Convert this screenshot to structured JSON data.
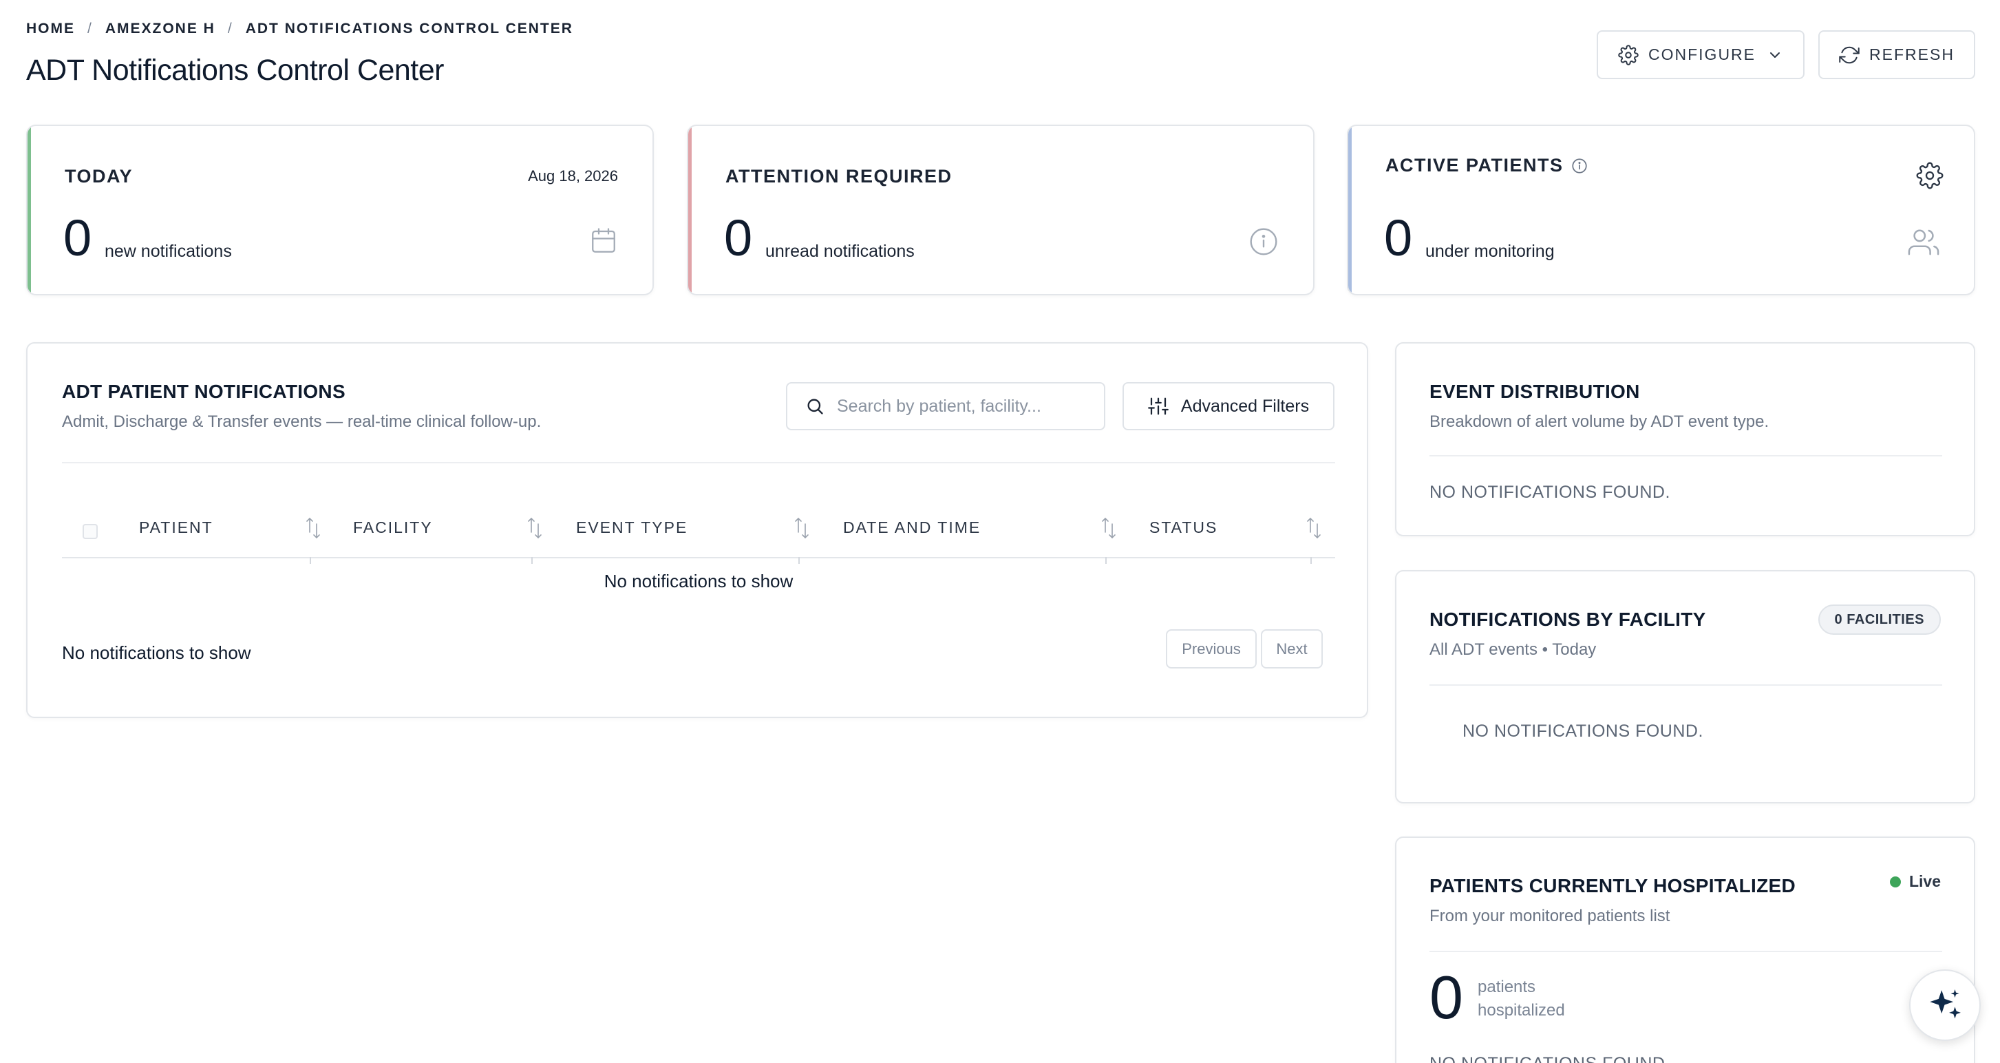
{
  "breadcrumb": {
    "items": [
      "HOME",
      "AMEXZONE H",
      "ADT NOTIFICATIONS CONTROL CENTER"
    ],
    "separator": "/"
  },
  "page": {
    "title": "ADT Notifications Control Center"
  },
  "toolbar": {
    "configure_label": "CONFIGURE",
    "refresh_label": "REFRESH"
  },
  "stats": {
    "today": {
      "label": "TODAY",
      "date": "Aug 18, 2026",
      "value": "0",
      "sub": "new notifications",
      "accent": "#7dbf8e",
      "icon": "calendar-icon"
    },
    "attention": {
      "label": "ATTENTION REQUIRED",
      "value": "0",
      "sub": "unread notifications",
      "accent": "#e0a3a8",
      "icon": "info-icon"
    },
    "active": {
      "label": "ACTIVE PATIENTS",
      "value": "0",
      "sub": "under monitoring",
      "accent": "#a9bde0",
      "icon": "users-icon"
    }
  },
  "notifications": {
    "title": "ADT PATIENT NOTIFICATIONS",
    "subtitle": "Admit, Discharge & Transfer events — real-time clinical follow-up.",
    "search_placeholder": "Search by patient, facility...",
    "filters_label": "Advanced Filters",
    "columns": [
      "PATIENT",
      "FACILITY",
      "EVENT TYPE",
      "DATE AND TIME",
      "STATUS"
    ],
    "empty_message": "No notifications to show",
    "footer_message": "No notifications to show",
    "previous_label": "Previous",
    "next_label": "Next"
  },
  "event_distribution": {
    "title": "EVENT DISTRIBUTION",
    "subtitle": "Breakdown of alert volume by ADT event type.",
    "empty": "NO NOTIFICATIONS FOUND."
  },
  "by_facility": {
    "title": "NOTIFICATIONS BY FACILITY",
    "badge": "0 FACILITIES",
    "subtitle": "All ADT events • Today",
    "empty": "NO NOTIFICATIONS FOUND."
  },
  "hospitalized": {
    "title": "PATIENTS CURRENTLY HOSPITALIZED",
    "live_label": "Live",
    "subtitle": "From your monitored patients list",
    "value": "0",
    "sub": "patients hospitalized",
    "empty": "NO NOTIFICATIONS FOUND."
  },
  "colors": {
    "live_dot": "#3ea55a",
    "fab_star": "#0f2a4a"
  }
}
